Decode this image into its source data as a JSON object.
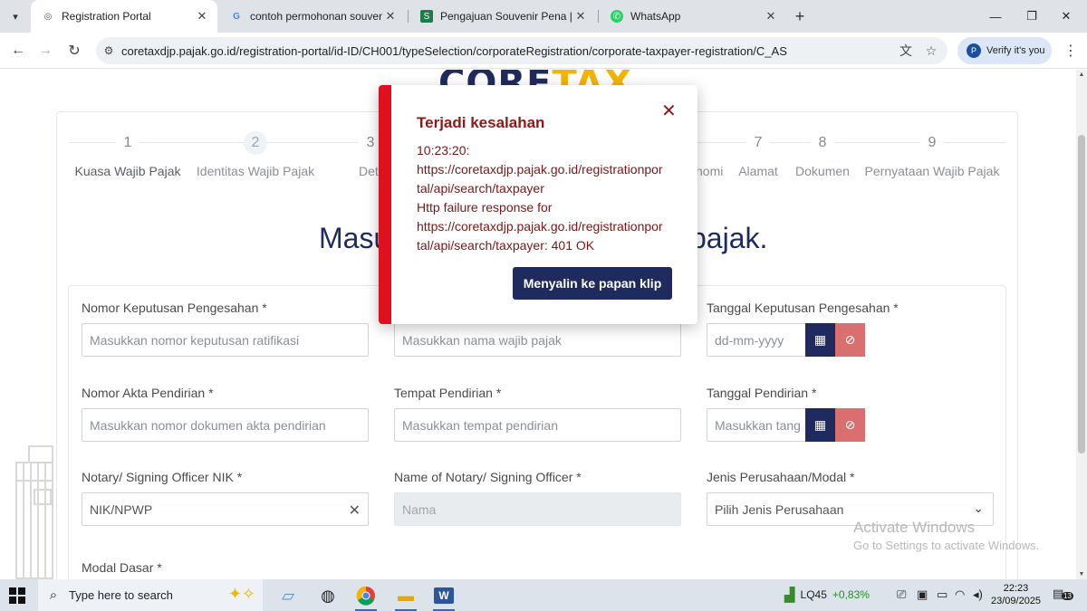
{
  "browser": {
    "tabs": [
      {
        "title": "Registration Portal",
        "favicon": "globe-icon"
      },
      {
        "title": "contoh permohonan souvenir k",
        "favicon": "google-icon"
      },
      {
        "title": "Pengajuan Souvenir Pena | PDF",
        "favicon": "scribd-icon"
      },
      {
        "title": "WhatsApp",
        "favicon": "whatsapp-icon"
      }
    ],
    "url": "coretaxdjp.pajak.go.id/registration-portal/id-ID/CH001/typeSelection/corporateRegistration/corporate-taxpayer-registration/C_AS",
    "verify_label": "Verify it's you"
  },
  "page": {
    "steps": [
      {
        "num": "1",
        "label": "Kuasa Wajib Pajak"
      },
      {
        "num": "2",
        "label": "Identitas Wajib Pajak"
      },
      {
        "num": "3",
        "label": "Detail K"
      },
      {
        "num": "7",
        "label": "Alamat"
      },
      {
        "num": "8",
        "label": "Dokumen"
      },
      {
        "num": "9",
        "label": "Pernyataan Wajib Pajak"
      }
    ],
    "step_partial_label": "nomi",
    "headline_left": "Masu",
    "headline_right": "pajak.",
    "fields": {
      "nomor_keputusan": {
        "label": "Nomor Keputusan Pengesahan *",
        "placeholder": "Masukkan nomor keputusan ratifikasi"
      },
      "nama_wajib_pajak": {
        "placeholder": "Masukkan nama wajib pajak"
      },
      "tanggal_keputusan": {
        "label": "Tanggal Keputusan Pengesahan *",
        "placeholder": "dd-mm-yyyy"
      },
      "nomor_akta": {
        "label": "Nomor Akta Pendirian *",
        "placeholder": "Masukkan nomor dokumen akta pendirian"
      },
      "tempat_pendirian": {
        "label": "Tempat Pendirian *",
        "placeholder": "Masukkan tempat pendirian"
      },
      "tanggal_pendirian": {
        "label": "Tanggal Pendirian *",
        "placeholder": "Masukkan tang"
      },
      "notary_nik": {
        "label": "Notary/ Signing Officer NIK *",
        "value": "NIK/NPWP"
      },
      "notary_name": {
        "label": "Name of Notary/ Signing Officer *",
        "placeholder": "Nama"
      },
      "jenis_perusahaan": {
        "label": "Jenis Perusahaan/Modal *",
        "selected": "Pilih Jenis Perusahaan"
      },
      "modal_dasar": {
        "label": "Modal Dasar *"
      }
    },
    "activate": {
      "line1": "Activate Windows",
      "line2": "Go to Settings to activate Windows."
    }
  },
  "dialog": {
    "title": "Terjadi kesalahan",
    "lines": [
      "10:23:20:",
      "https://coretaxdjp.pajak.go.id/registrationpor",
      "tal/api/search/taxpayer",
      "Http failure response for",
      "https://coretaxdjp.pajak.go.id/registrationpor",
      "tal/api/search/taxpayer: 401 OK"
    ],
    "copy_button": "Menyalin ke papan klip",
    "accent_color": "#e0101e"
  },
  "taskbar": {
    "search_placeholder": "Type here to search",
    "stock_name": "LQ45",
    "stock_change": "+0,83%",
    "time": "22:23",
    "date": "23/09/2025",
    "notification_count": "13"
  }
}
